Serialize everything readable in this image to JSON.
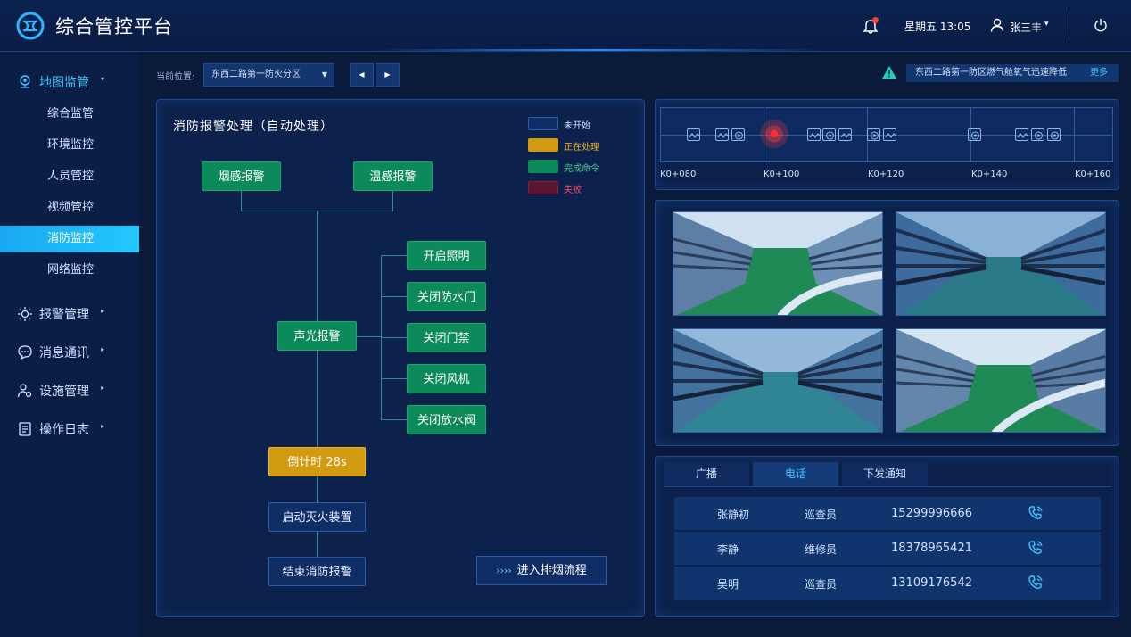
{
  "header": {
    "app_title": "综合管控平台",
    "datetime": "星期五 13:05",
    "user_name": "张三丰",
    "icons": [
      "logo-icon",
      "bell-icon",
      "user-icon",
      "power-icon"
    ]
  },
  "sidebar": {
    "groups": [
      {
        "label": "地图监管",
        "icon": "map-pin-icon",
        "expanded": true,
        "children": [
          "综合监管",
          "环境监控",
          "人员管控",
          "视频管控",
          "消防监控",
          "网络监控"
        ],
        "active_child": "消防监控"
      },
      {
        "label": "报警管理",
        "icon": "alarm-icon"
      },
      {
        "label": "消息通讯",
        "icon": "chat-icon"
      },
      {
        "label": "设施管理",
        "icon": "facility-icon"
      },
      {
        "label": "操作日志",
        "icon": "log-icon"
      }
    ]
  },
  "location": {
    "label": "当前位置:",
    "selected": "东西二路第一防火分区"
  },
  "alert": {
    "message": "东西二路第一防区燃气舱氧气迅速降低",
    "more": "更多"
  },
  "flow": {
    "title": "消防报警处理（自动处理）",
    "legend": [
      {
        "label": "未开始",
        "color": "#102e66",
        "text_color": "#cfe3ff"
      },
      {
        "label": "正在处理",
        "color": "#d19a10",
        "text_color": "#e9b420"
      },
      {
        "label": "完成命令",
        "color": "#0d8a5a",
        "text_color": "#3fd08e"
      },
      {
        "label": "失败",
        "color": "#5a1530",
        "text_color": "#ff4d6d"
      }
    ],
    "nodes": {
      "smoke": "烟感报警",
      "temp": "温感报警",
      "sound_light": "声光报警",
      "light_on": "开启照明",
      "close_flood_door": "关闭防水门",
      "close_access": "关闭门禁",
      "close_fan": "关闭风机",
      "close_drain_valve": "关闭放水阀",
      "countdown": "倒计时 28s",
      "start_extinguisher": "启动灭火装置",
      "end_alarm": "结束消防报警"
    },
    "smoke_flow_button": "进入排烟流程",
    "smoke_flow_chevrons": "››››"
  },
  "ruler": {
    "ticks": [
      "K0+080",
      "K0+100",
      "K0+120",
      "K0+140",
      "K0+160"
    ],
    "fire_marker": "alarm-location-icon"
  },
  "cameras": [
    "tunnel-camera-1",
    "tunnel-camera-2",
    "tunnel-camera-3",
    "tunnel-camera-4"
  ],
  "contacts": {
    "tabs": [
      "广播",
      "电话",
      "下发通知"
    ],
    "active_tab": "电话",
    "rows": [
      {
        "name": "张静初",
        "role": "巡查员",
        "phone": "15299996666"
      },
      {
        "name": "李静",
        "role": "维修员",
        "phone": "18378965421"
      },
      {
        "name": "吴明",
        "role": "巡查员",
        "phone": "13109176542"
      }
    ]
  },
  "colors": {
    "accent": "#3ec7ff",
    "active_nav": "#1aa8f0",
    "done": "#0d8a5a",
    "processing": "#d19a10",
    "pending": "#102e66",
    "fail": "#5a1530"
  }
}
